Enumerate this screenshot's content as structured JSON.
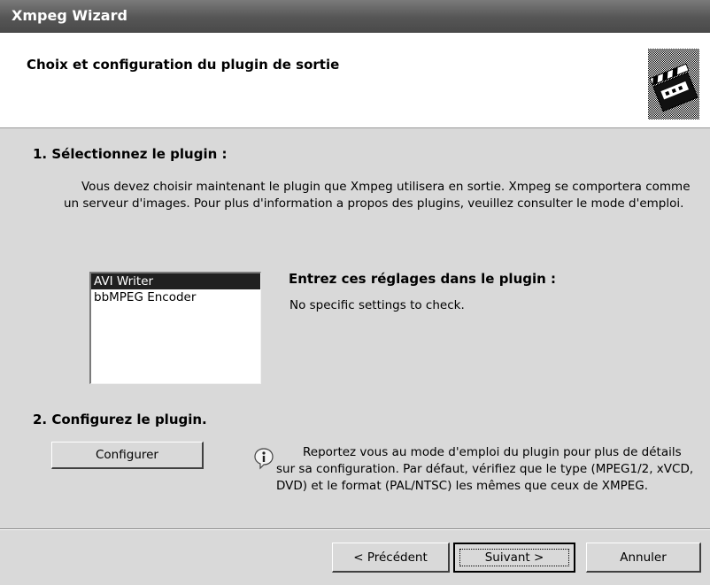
{
  "window": {
    "title": "Xmpeg Wizard"
  },
  "header": {
    "title": "Choix et configuration du plugin de sortie",
    "icon": "clapperboard-icon"
  },
  "step1": {
    "heading": "1. Sélectionnez le plugin :",
    "description": "Vous devez choisir maintenant le plugin que Xmpeg utilisera en sortie. Xmpeg se comportera comme un serveur d'images. Pour plus d'information a propos des plugins, veuillez consulter le mode d'emploi."
  },
  "plugins": {
    "items": [
      {
        "label": "AVI Writer",
        "selected": true
      },
      {
        "label": "bbMPEG Encoder",
        "selected": false
      }
    ]
  },
  "settings": {
    "heading": "Entrez ces réglages dans le plugin :",
    "text": "No specific settings to check."
  },
  "step2": {
    "heading": "2. Configurez le plugin.",
    "configure_label": "Configurer",
    "info_icon": "info-icon",
    "info_text": "Reportez vous au mode d'emploi du plugin pour plus de détails sur sa configuration. Par défaut, vérifiez que le type (MPEG1/2, xVCD, DVD) et le format (PAL/NTSC) les mêmes que ceux de XMPEG."
  },
  "footer": {
    "back_label": "< Précédent",
    "next_label": "Suivant >",
    "cancel_label": "Annuler"
  }
}
